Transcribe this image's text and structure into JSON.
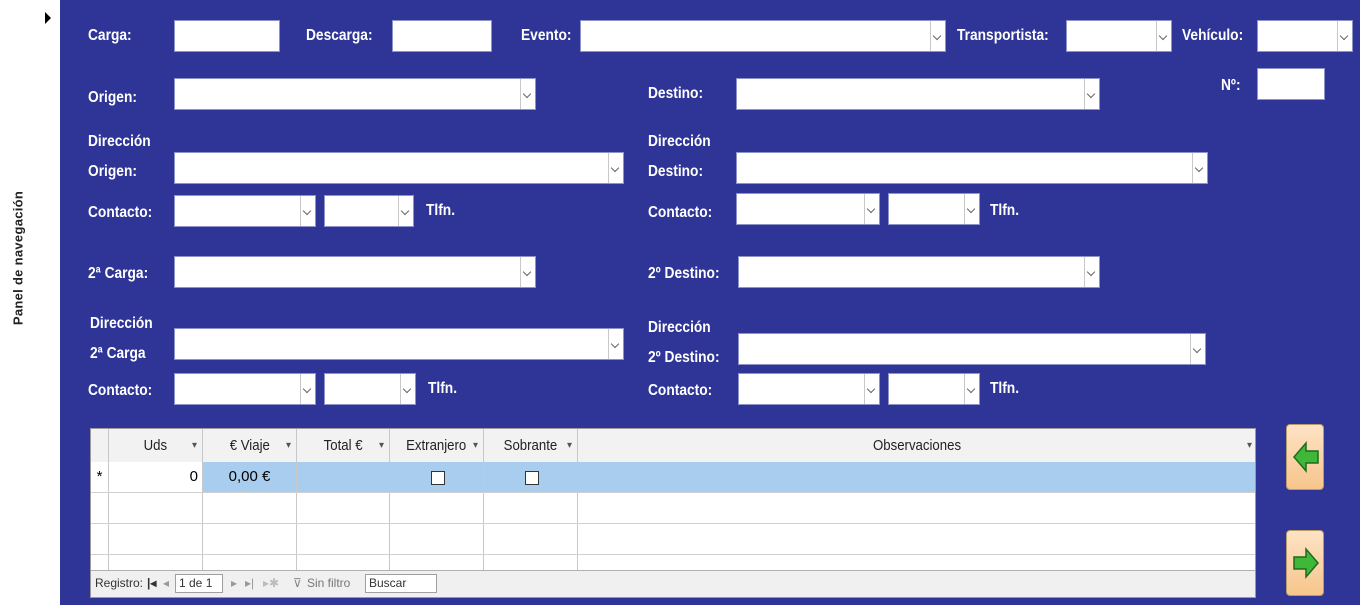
{
  "nav_panel": {
    "label": "Panel de navegación"
  },
  "labels": {
    "carga": "Carga:",
    "descarga": "Descarga:",
    "evento": "Evento:",
    "transportista": "Transportista:",
    "vehiculo": "Vehículo:",
    "origen": "Origen:",
    "destino": "Destino:",
    "numero": "Nº:",
    "direccion_origen_1": "Dirección",
    "direccion_origen_2": "Origen:",
    "direccion_destino_1": "Dirección",
    "direccion_destino_2": "Destino:",
    "contacto": "Contacto:",
    "tlfn": "Tlfn.",
    "segunda_carga": "2ª Carga:",
    "segundo_destino": "2º Destino:",
    "direccion_2carga_1": "Dirección",
    "direccion_2carga_2": "2ª Carga",
    "direccion_2destino_1": "Dirección",
    "direccion_2destino_2": "2º Destino:"
  },
  "subform": {
    "columns": [
      "Uds",
      "€ Viaje",
      "Total €",
      "Extranjero",
      "Sobrante",
      "Observaciones"
    ],
    "new_row": {
      "marker": "*",
      "uds": "0",
      "viaje": "0,00 €"
    },
    "navigation": {
      "registro_label": "Registro:",
      "position": "1 de 1",
      "filter": "Sin filtro",
      "search": "Buscar"
    }
  },
  "buttons": {
    "previous": "arrow-left-icon",
    "next": "arrow-right-icon"
  },
  "colors": {
    "form_background": "#2e3596",
    "selected_row": "#a8cdee",
    "arrow_green": "#3fb83a",
    "button_face": "#f7c58c"
  }
}
